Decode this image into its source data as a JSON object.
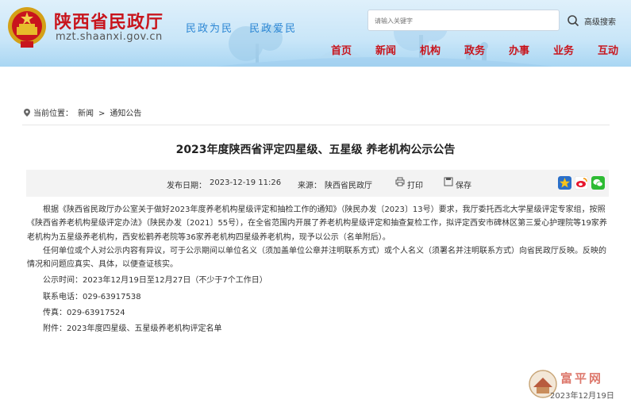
{
  "header": {
    "site_title": "陕西省民政厅",
    "domain": "mzt.shaanxi.gov.cn",
    "slogans": [
      "民政为民",
      "民政爱民"
    ],
    "search_placeholder": "请输入关键字",
    "advanced_search": "高级搜索"
  },
  "nav": [
    "首页",
    "新闻",
    "机构",
    "政务",
    "办事",
    "业务",
    "互动"
  ],
  "breadcrumb": {
    "label": "当前位置：",
    "items": [
      "新闻",
      "通知公告"
    ],
    "separator": ">"
  },
  "article": {
    "title": "2023年度陕西省评定四星级、五星级 养老机构公示公告",
    "publish_label": "发布日期：",
    "publish_date": "2023-12-19 11:26",
    "source_label": "来源：",
    "source": "陕西省民政厅",
    "print_label": "打印",
    "save_label": "保存",
    "paragraphs": [
      "根据《陕西省民政厅办公室关于做好2023年度养老机构星级评定和抽检工作的通知》（陕民办发〔2023〕13号）要求，我厅委托西北大学星级评定专家组，按照《陕西省养老机构星级评定办法》（陕民办发〔2021〕55号），在全省范围内开展了养老机构星级评定和抽查复检工作，拟评定西安市碑林区第三爱心护理院等19家养老机构为五星级养老机构，西安松鹤养老院等36家养老机构四星级养老机构，现予以公示（名单附后）。",
      "任何单位或个人对公示内容有异议，可于公示期间以单位名义（须加盖单位公章并注明联系方式）或个人名义（须署名并注明联系方式）向省民政厅反映。反映的情况和问题应真实、具体，以便查证核实。"
    ],
    "lines": [
      "公示时间：2023年12月19日至12月27日（不少于7个工作日）",
      "联系电话：029-63917538",
      "传真：029-63917524",
      "附件：2023年度四星级、五星级养老机构评定名单"
    ]
  },
  "watermark": {
    "text": "富平网",
    "date": "2023年12月19日"
  },
  "colors": {
    "brand_red": "#c8151d",
    "accent_blue": "#2b86d4"
  }
}
